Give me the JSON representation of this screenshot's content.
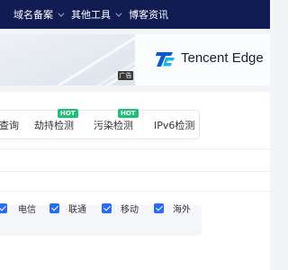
{
  "nav": {
    "items": [
      {
        "label": "域名备案",
        "has_dropdown": true
      },
      {
        "label": "其他工具",
        "has_dropdown": true
      },
      {
        "label": "博客资讯",
        "has_dropdown": false
      }
    ],
    "background": "#111c52"
  },
  "banner": {
    "ad_label": "广告",
    "brand_text": "Tencent Edge",
    "logo_icon": "tencent-edgeone-logo"
  },
  "tabs": [
    {
      "label": "查询",
      "hot": false
    },
    {
      "label": "劫持检测",
      "hot": true,
      "badge": "HOT"
    },
    {
      "label": "污染检测",
      "hot": true,
      "badge": "HOT"
    },
    {
      "label": "IPv6检测",
      "hot": false
    }
  ],
  "carriers": [
    {
      "label": "电信",
      "checked": true
    },
    {
      "label": "联通",
      "checked": true
    },
    {
      "label": "移动",
      "checked": true
    },
    {
      "label": "海外",
      "checked": true
    }
  ],
  "colors": {
    "accent": "#2a6cf6",
    "hot_badge": "#1fbf78"
  }
}
